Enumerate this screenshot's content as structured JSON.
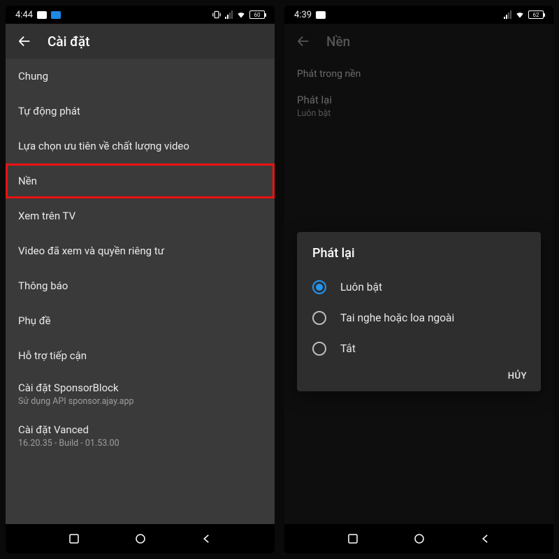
{
  "left": {
    "status": {
      "time": "4:44",
      "battery": "60"
    },
    "title": "Cài đặt",
    "items": [
      {
        "label": "Chung"
      },
      {
        "label": "Tự động phát"
      },
      {
        "label": "Lựa chọn ưu tiên về chất lượng video"
      },
      {
        "label": "Nền",
        "highlighted": true
      },
      {
        "label": "Xem trên TV"
      },
      {
        "label": "Video đã xem và quyền riêng tư"
      },
      {
        "label": "Thông báo"
      },
      {
        "label": "Phụ đề"
      },
      {
        "label": "Hỗ trợ tiếp cận"
      },
      {
        "label": "Cài đặt SponsorBlock",
        "sub": "Sử dụng API sponsor.ajay.app"
      },
      {
        "label": "Cài đặt Vanced",
        "sub": "16.20.35 - Build - 01.53.00"
      }
    ]
  },
  "right": {
    "status": {
      "time": "4:39",
      "battery": "62"
    },
    "title": "Nền",
    "section_header": "Phát trong nền",
    "bg_item": {
      "label": "Phát lại",
      "sub": "Luôn bật"
    },
    "dialog": {
      "title": "Phát lại",
      "options": [
        {
          "label": "Luôn bật",
          "checked": true
        },
        {
          "label": "Tai nghe hoặc loa ngoài",
          "checked": false
        },
        {
          "label": "Tắt",
          "checked": false
        }
      ],
      "cancel": "HỦY"
    }
  }
}
